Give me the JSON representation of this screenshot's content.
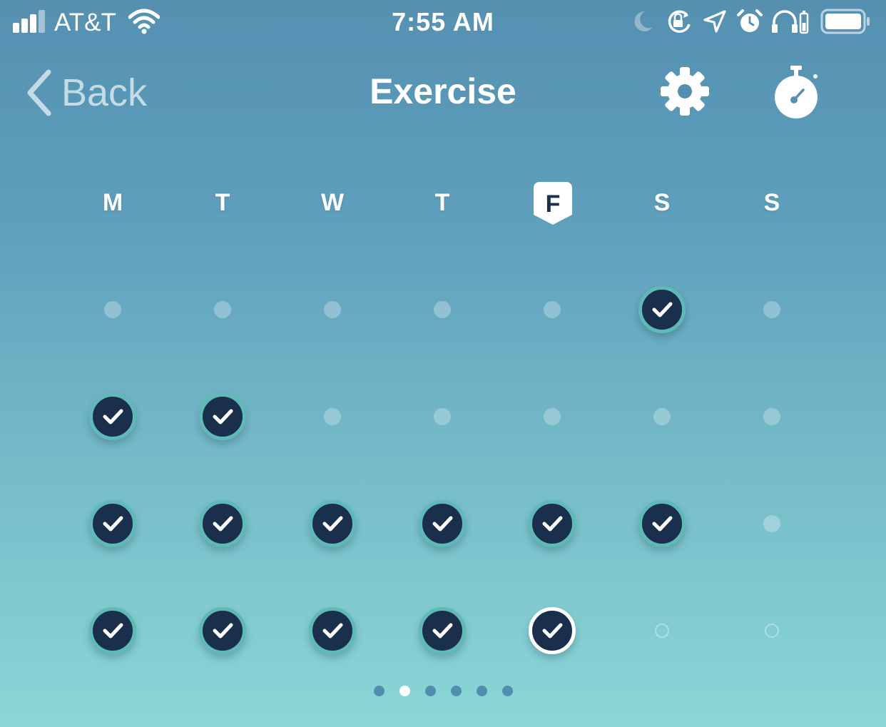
{
  "status_bar": {
    "carrier": "AT&T",
    "time": "7:55 AM",
    "icons": [
      "signal-icon",
      "wifi-icon",
      "moon-icon",
      "rotation-lock-icon",
      "location-arrow-icon",
      "alarm-icon",
      "headphones-battery-icon",
      "battery-icon"
    ],
    "signal_bars_filled": 3,
    "signal_bars_total": 4,
    "battery_level": 1.0
  },
  "nav": {
    "back_label": "Back",
    "title": "Exercise",
    "settings_icon": "gear-icon",
    "timer_icon": "stopwatch-icon"
  },
  "week": {
    "days": [
      "M",
      "T",
      "W",
      "T",
      "F",
      "S",
      "S"
    ],
    "today_index": 4
  },
  "weeks": [
    [
      "empty",
      "empty",
      "empty",
      "empty",
      "empty",
      "done",
      "empty"
    ],
    [
      "done",
      "done",
      "empty",
      "empty",
      "empty",
      "empty",
      "empty"
    ],
    [
      "done",
      "done",
      "done",
      "done",
      "done",
      "done",
      "empty"
    ],
    [
      "done",
      "done",
      "done",
      "done",
      "today-done",
      "future",
      "future"
    ]
  ],
  "pager": {
    "count": 6,
    "active_index": 1
  },
  "colors": {
    "background_top": "#5590b1",
    "background_bottom": "#8ad7d6",
    "check_fill": "#1a2f4b",
    "check_ring": "#5fb9b6",
    "today_ring": "#ffffff",
    "pager_inactive": "#4f8fad"
  }
}
